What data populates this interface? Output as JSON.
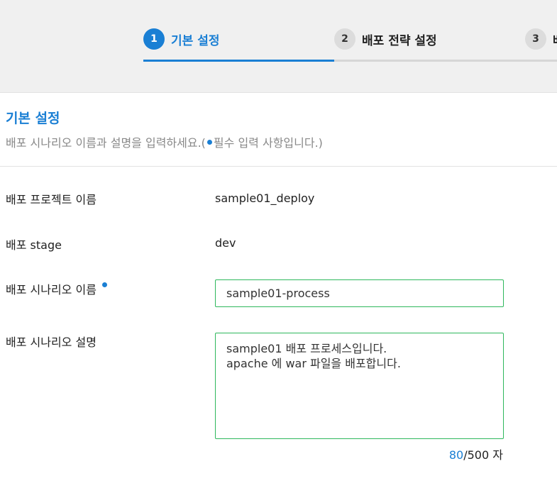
{
  "stepper": {
    "steps": [
      {
        "number": "1",
        "label": "기본 설정",
        "state": "active"
      },
      {
        "number": "2",
        "label": "배포 전략 설정",
        "state": "inactive"
      },
      {
        "number": "3",
        "label": "배",
        "state": "inactive"
      }
    ]
  },
  "section": {
    "title": "기본 설정",
    "description_prefix": "배포 시나리오 이름과 설명을 입력하세요.(",
    "description_suffix": "필수 입력 사항입니다.)"
  },
  "form": {
    "project_name": {
      "label": "배포 프로젝트 이름",
      "value": "sample01_deploy"
    },
    "stage": {
      "label": "배포 stage",
      "value": "dev"
    },
    "scenario_name": {
      "label": "배포 시나리오 이름",
      "value": "sample01-process",
      "required": true
    },
    "scenario_desc": {
      "label": "배포 시나리오 설명",
      "value": "sample01 배포 프로세스입니다.\napache 에 war 파일을 배포합니다.",
      "count": "80",
      "max": "/500",
      "unit": "자"
    }
  },
  "colors": {
    "accent": "#1a7fd4",
    "input_border": "#2eb85c",
    "header_bg": "#f0f0f0"
  }
}
